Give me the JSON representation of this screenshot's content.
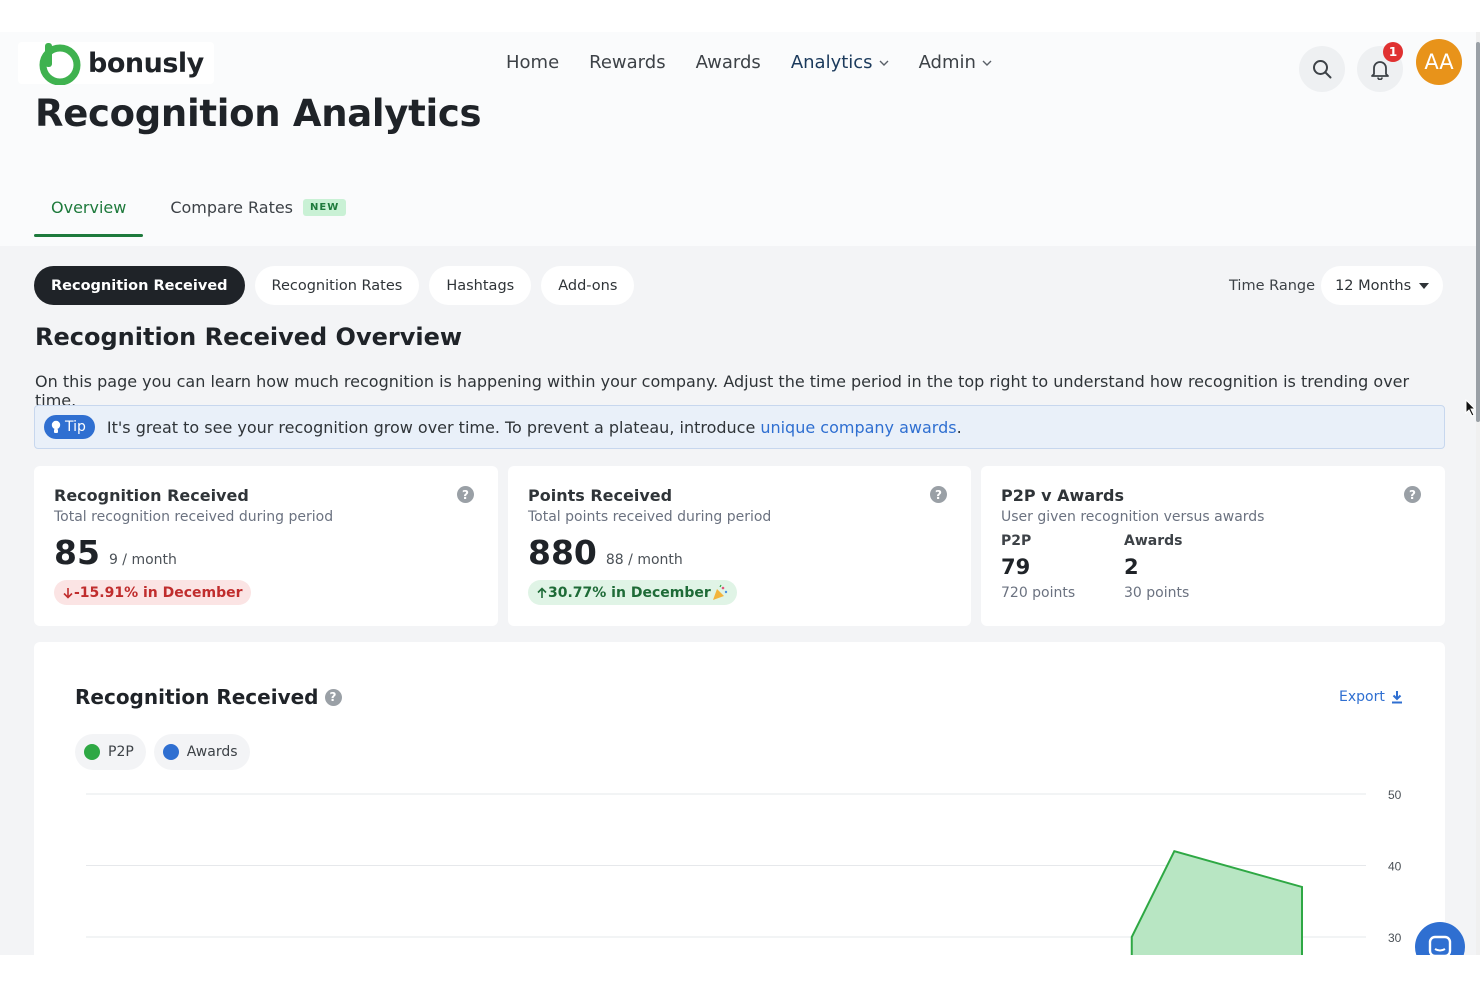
{
  "brand": {
    "name": "bonusly",
    "logo_color": "#3fb24f"
  },
  "nav": {
    "items": [
      {
        "label": "Home",
        "has_dropdown": false,
        "active": false
      },
      {
        "label": "Rewards",
        "has_dropdown": false,
        "active": false
      },
      {
        "label": "Awards",
        "has_dropdown": false,
        "active": false
      },
      {
        "label": "Analytics",
        "has_dropdown": true,
        "active": true
      },
      {
        "label": "Admin",
        "has_dropdown": true,
        "active": false
      }
    ],
    "notification_count": "1",
    "avatar_initials": "AA",
    "avatar_color": "#e8931a"
  },
  "page": {
    "title": "Recognition Analytics",
    "tabs": [
      {
        "label": "Overview",
        "active": true
      },
      {
        "label": "Compare Rates",
        "badge": "NEW",
        "active": false
      }
    ]
  },
  "filters": {
    "pills": [
      {
        "label": "Recognition Received",
        "active": true
      },
      {
        "label": "Recognition Rates",
        "active": false
      },
      {
        "label": "Hashtags",
        "active": false
      },
      {
        "label": "Add-ons",
        "active": false
      }
    ],
    "time_range_label": "Time Range",
    "time_range_value": "12 Months"
  },
  "overview": {
    "title": "Recognition Received Overview",
    "description": "On this page you can learn how much recognition is happening within your company. Adjust the time period in the top right to understand how recognition is trending over time.",
    "tip_badge": "Tip",
    "tip_text": "It's great to see your recognition grow over time. To prevent a plateau, introduce",
    "tip_link": "unique company awards",
    "tip_end": "."
  },
  "cards": {
    "recognition": {
      "title": "Recognition Received",
      "subtitle": "Total recognition received during period",
      "value": "85",
      "rate": "9 / month",
      "delta": "-15.91% in December"
    },
    "points": {
      "title": "Points Received",
      "subtitle": "Total points received during period",
      "value": "880",
      "rate": "88 / month",
      "delta": "30.77% in December"
    },
    "p2p": {
      "title": "P2P v Awards",
      "subtitle": "User given recognition versus awards",
      "p2p_label": "P2P",
      "p2p_value": "79",
      "p2p_points": "720 points",
      "awards_label": "Awards",
      "awards_value": "2",
      "awards_points": "30 points"
    }
  },
  "chart_section": {
    "title": "Recognition Received",
    "export_label": "Export",
    "legend": [
      {
        "label": "P2P",
        "color": "#2ea844"
      },
      {
        "label": "Awards",
        "color": "#2f6fd1"
      }
    ]
  },
  "chart_data": {
    "type": "area",
    "title": "Recognition Received",
    "series": [
      {
        "name": "P2P",
        "color": "#2ea844",
        "visible_points": [
          {
            "x_frac": 0.86,
            "y": 30
          },
          {
            "x_frac": 0.895,
            "y": 42
          },
          {
            "x_frac": 1.0,
            "y": 37
          }
        ]
      },
      {
        "name": "Awards",
        "color": "#2f6fd1"
      }
    ],
    "y_ticks": [
      "50",
      "40",
      "30"
    ],
    "ylim": [
      30,
      50
    ],
    "grid": true,
    "y_axis_side": "right"
  }
}
